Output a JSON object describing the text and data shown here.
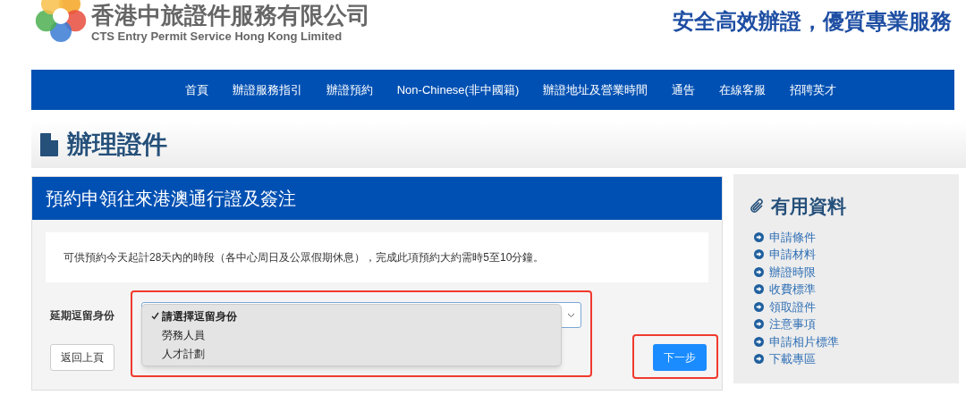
{
  "header": {
    "company_name": "香港中旅證件服務有限公司",
    "company_name_en": "CTS Entry Permit Service Hong Kong Limited",
    "slogan": "安全高效辦證，優質專業服務"
  },
  "nav": [
    "首頁",
    "辦證服務指引",
    "辦證預約",
    "Non-Chinese(非中國籍)",
    "辦證地址及營業時間",
    "通告",
    "在線客服",
    "招聘英才"
  ],
  "page_title": "辦理證件",
  "form": {
    "title": "預約申領往來港澳通行證及簽注",
    "notice": "可供預約今天起計28天內的時段（各中心周日及公眾假期休息），完成此項預約大約需時5至10分鐘。",
    "field_label": "延期逗留身份",
    "dropdown": {
      "expanded": true,
      "highlighted": true,
      "options": [
        {
          "label": "請選擇逗留身份",
          "selected": true
        },
        {
          "label": "勞務人員",
          "selected": false
        },
        {
          "label": "人才計劃",
          "selected": false
        }
      ]
    },
    "back_button": "返回上頁",
    "next_button": {
      "label": "下一步",
      "highlighted": true
    }
  },
  "sidebar": {
    "title": "有用資料",
    "links": [
      "申請條件",
      "申請材料",
      "辦證時限",
      "收費標準",
      "領取證件",
      "注意事項",
      "申請相片標準",
      "下載專區"
    ]
  }
}
